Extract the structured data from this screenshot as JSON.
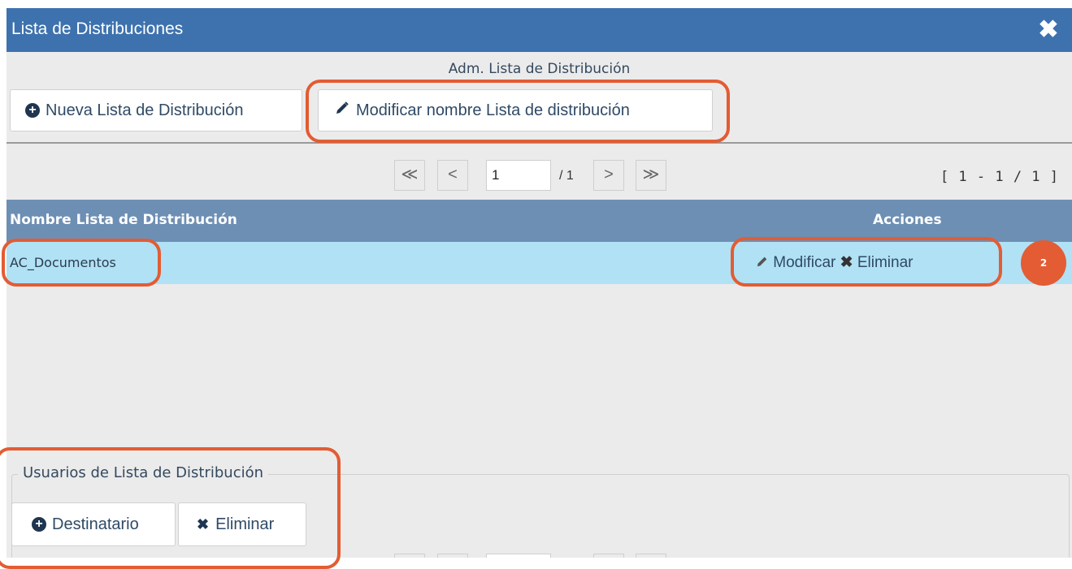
{
  "dialog": {
    "title": "Lista de Distribuciones",
    "close_symbol": "✖",
    "section_caption": "Adm. Lista de Distribución"
  },
  "toolbar": {
    "new_list_label": "Nueva Lista de Distribución",
    "rename_list_label": "Modificar nombre Lista de distribución"
  },
  "pager": {
    "first": "≪",
    "prev": "<",
    "current_page": "1",
    "total_pages": "/ 1",
    "next": ">",
    "last": "≫",
    "range": "[ 1 - 1 / 1 ]"
  },
  "table": {
    "columns": [
      "Nombre Lista de Distribución",
      "Acciones"
    ],
    "rows": [
      {
        "name": "AC_Documentos",
        "action_modify": "Modificar",
        "action_delete": "Eliminar"
      }
    ]
  },
  "users_section": {
    "legend": "Usuarios de Lista de Distribución",
    "add_recipient_label": "Destinatario",
    "delete_label": "Eliminar"
  },
  "annotation": {
    "step_number": "2",
    "color": "#e35c33"
  },
  "colors": {
    "titlebar": "#3d72ae",
    "header": "#6e8fb4",
    "selected_row": "#b1e1f4"
  }
}
